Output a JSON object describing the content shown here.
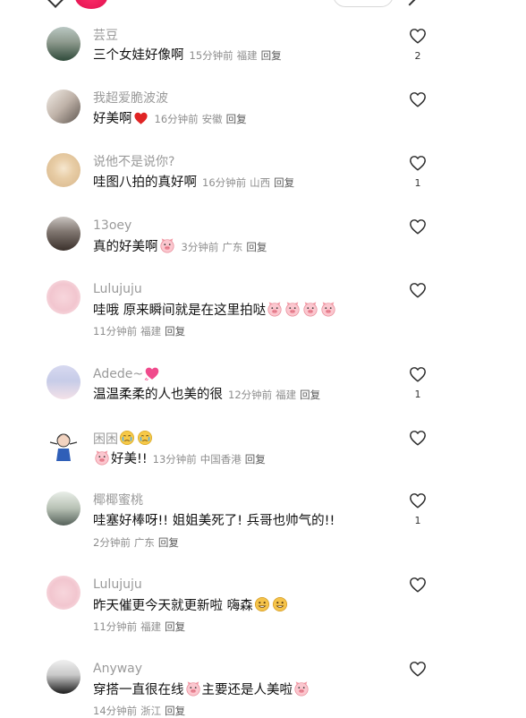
{
  "comments": [
    {
      "name": "芸豆",
      "text": "三个女娃好像啊",
      "time": "15分钟前",
      "location": "福建",
      "reply": "回复",
      "likes": "2"
    },
    {
      "name": "我超爱脆波波",
      "text": "好美啊",
      "time": "16分钟前",
      "location": "安徽",
      "reply": "回复",
      "likes": ""
    },
    {
      "name": "说他不是说你?",
      "text": "哇图八拍的真好啊",
      "time": "16分钟前",
      "location": "山西",
      "reply": "回复",
      "likes": "1"
    },
    {
      "name": "13oey",
      "text": "真的好美啊",
      "time": "3分钟前",
      "location": "广东",
      "reply": "回复",
      "likes": ""
    },
    {
      "name": "Lulujuju",
      "text": "哇哦 原来瞬间就是在这里拍哒",
      "time": "11分钟前",
      "location": "福建",
      "reply": "回复",
      "likes": ""
    },
    {
      "name": "Adede~",
      "text": "温温柔柔的人也美的很",
      "time": "12分钟前",
      "location": "福建",
      "reply": "回复",
      "likes": "1"
    },
    {
      "name": "困困",
      "text": "好美!!",
      "time": "13分钟前",
      "location": "中国香港",
      "reply": "回复",
      "likes": ""
    },
    {
      "name": "椰椰蜜桃",
      "text": "哇塞好棒呀!! 姐姐美死了! 兵哥也帅气的!!",
      "time": "2分钟前",
      "location": "广东",
      "reply": "回复",
      "likes": "1"
    },
    {
      "name": "Lulujuju",
      "text": "昨天催更今天就更新啦 嗨森",
      "time": "11分钟前",
      "location": "福建",
      "reply": "回复",
      "likes": ""
    },
    {
      "name": "Anyway",
      "text": "穿搭一直很在线",
      "text2": "主要还是人美啦",
      "time": "14分钟前",
      "location": "浙江",
      "reply": "回复",
      "likes": ""
    }
  ]
}
